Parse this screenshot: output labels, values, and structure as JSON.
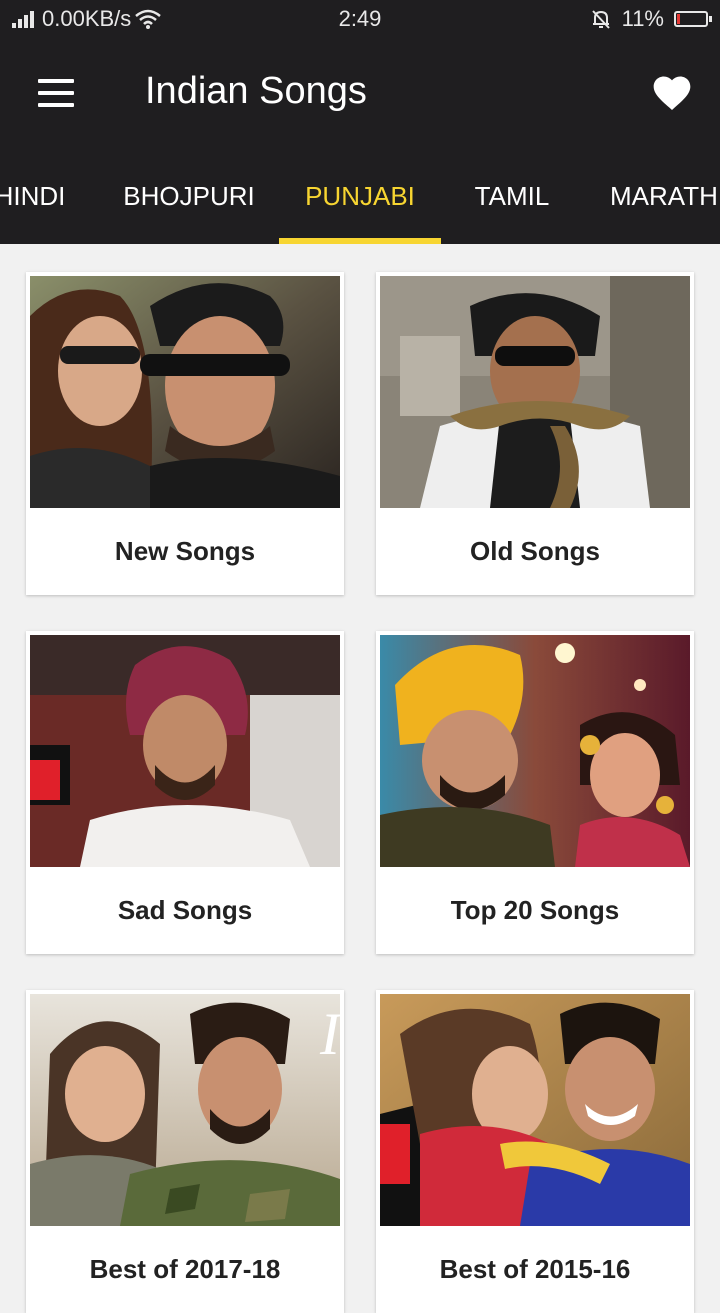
{
  "status_bar": {
    "network_speed": "0.00KB/s",
    "time": "2:49",
    "battery_percent": "11%",
    "battery_level": 0.11,
    "signal_icon": "signal-icon",
    "wifi_icon": "wifi-icon",
    "mute_icon": "bell-off-icon"
  },
  "app_bar": {
    "title": "Indian Songs",
    "menu_icon": "hamburger-menu-icon",
    "favorite_icon": "heart-icon"
  },
  "tabs": [
    {
      "label": "HINDI"
    },
    {
      "label": "BHOJPURI"
    },
    {
      "label": "PUNJABI",
      "active": true
    },
    {
      "label": "TAMIL"
    },
    {
      "label": "MARATHI"
    }
  ],
  "colors": {
    "app_bar": "#1f1e20",
    "accent": "#f7d531",
    "background": "#f1f1f1",
    "battery_low": "#e53935"
  },
  "cards": [
    {
      "label": "New Songs"
    },
    {
      "label": "Old Songs"
    },
    {
      "label": "Sad Songs"
    },
    {
      "label": "Top 20 Songs"
    },
    {
      "label": "Best of 2017-18"
    },
    {
      "label": "Best of 2015-16"
    }
  ]
}
